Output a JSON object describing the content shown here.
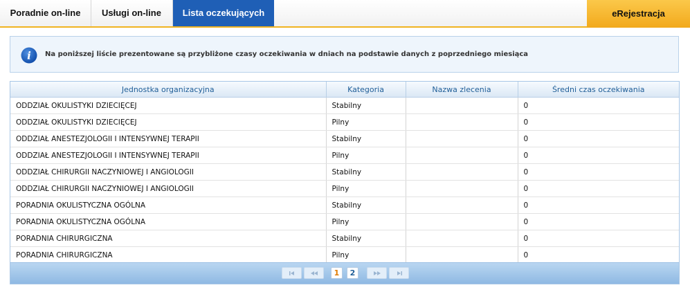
{
  "tabs": [
    {
      "label": "Poradnie on-line"
    },
    {
      "label": "Usługi on-line"
    },
    {
      "label": "Lista oczekujących"
    }
  ],
  "ereg_label": "eRejestracja",
  "info": {
    "icon": "info-icon",
    "text": "Na poniższej liście prezentowane są przybliżone czasy oczekiwania w dniach na podstawie danych z poprzedniego miesiąca"
  },
  "table": {
    "headers": [
      "Jednostka organizacyjna",
      "Kategoria",
      "Nazwa zlecenia",
      "Średni czas oczekiwania"
    ],
    "rows": [
      [
        "ODDZIAŁ OKULISTYKI DZIECIĘCEJ",
        "Stabilny",
        "",
        "0"
      ],
      [
        "ODDZIAŁ OKULISTYKI DZIECIĘCEJ",
        "Pilny",
        "",
        "0"
      ],
      [
        "ODDZIAŁ ANESTEZJOLOGII I INTENSYWNEJ TERAPII",
        "Stabilny",
        "",
        "0"
      ],
      [
        "ODDZIAŁ ANESTEZJOLOGII I INTENSYWNEJ TERAPII",
        "Pilny",
        "",
        "0"
      ],
      [
        "ODDZIAŁ CHIRURGII NACZYNIOWEJ I ANGIOLOGII",
        "Stabilny",
        "",
        "0"
      ],
      [
        "ODDZIAŁ CHIRURGII NACZYNIOWEJ I ANGIOLOGII",
        "Pilny",
        "",
        "0"
      ],
      [
        "PORADNIA OKULISTYCZNA OGÓLNA",
        "Stabilny",
        "",
        "0"
      ],
      [
        "PORADNIA OKULISTYCZNA OGÓLNA",
        "Pilny",
        "",
        "0"
      ],
      [
        "PORADNIA CHIRURGICZNA",
        "Stabilny",
        "",
        "0"
      ],
      [
        "PORADNIA CHIRURGICZNA",
        "Pilny",
        "",
        "0"
      ]
    ]
  },
  "pager": {
    "first_icon": "first-page-icon",
    "prev_icon": "prev-page-icon",
    "next_icon": "next-page-icon",
    "last_icon": "last-page-icon",
    "pages": [
      "1",
      "2"
    ],
    "current": "1"
  },
  "colors": {
    "active_tab": "#1f5fb6",
    "accent": "#f0b320",
    "header_text": "#215f98",
    "current_page": "#e07b00"
  }
}
